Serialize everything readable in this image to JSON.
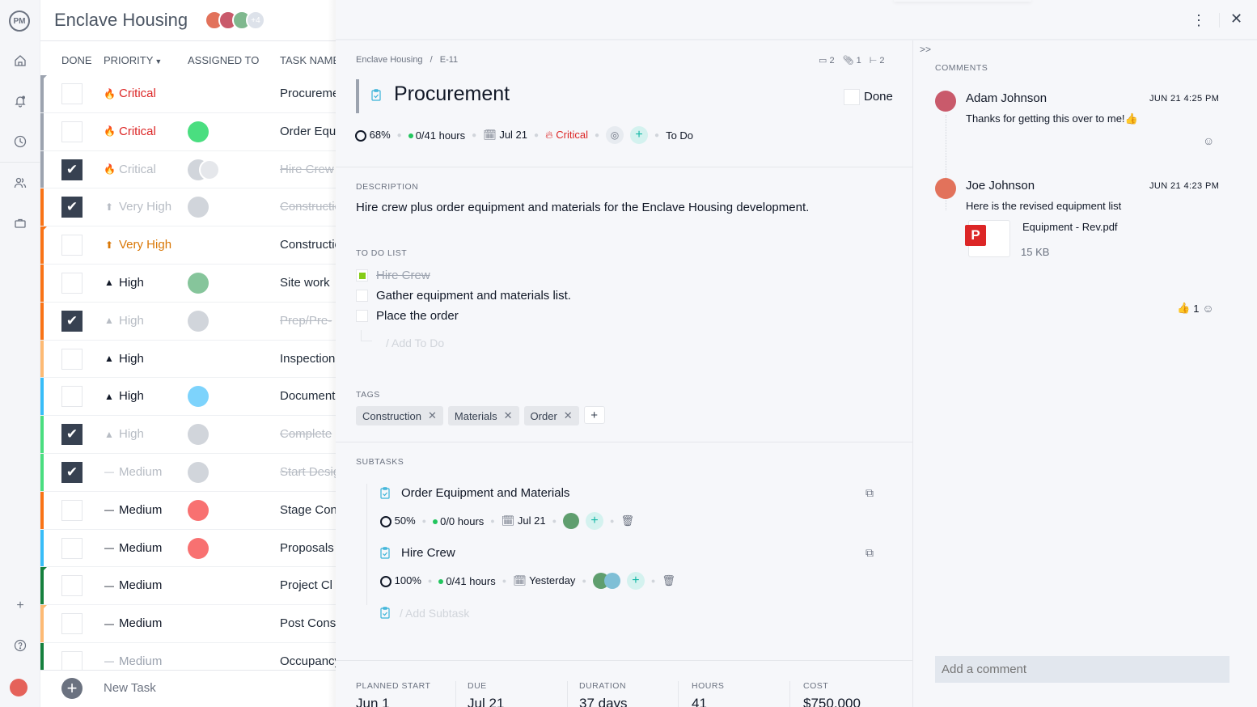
{
  "app": {
    "logo": "PM",
    "project_title": "Enclave Housing",
    "extra_members": "+4"
  },
  "nav": {
    "items": [
      "home",
      "notifications",
      "time",
      "people",
      "portfolio"
    ],
    "add": "+",
    "help": "?"
  },
  "list": {
    "columns": {
      "done": "DONE",
      "priority": "PRIORITY",
      "assigned": "ASSIGNED TO",
      "task": "TASK NAME"
    },
    "rows": [
      {
        "done": false,
        "priority": "Critical",
        "icon": "🔥",
        "color": "#dc2626",
        "task": "Procurement",
        "bar": "#9ca3af",
        "flag": "#9ca3af",
        "avatars": []
      },
      {
        "done": false,
        "priority": "Critical",
        "icon": "🔥",
        "color": "#dc2626",
        "task": "Order Equipment",
        "bar": "#9ca3af",
        "flag": "",
        "avatars": [
          "#4ade80"
        ]
      },
      {
        "done": true,
        "priority": "Critical",
        "icon": "🔥",
        "color": "#b7bcc4",
        "task": "Hire Crew",
        "bar": "#9ca3af",
        "flag": "",
        "avatars": [
          "#d1d5db",
          "#e5e7eb"
        ]
      },
      {
        "done": true,
        "priority": "Very High",
        "icon": "⬆",
        "color": "#b7bcc4",
        "task": "Construction",
        "bar": "#f97316",
        "flag": "",
        "avatars": [
          "#d1d5db"
        ]
      },
      {
        "done": false,
        "priority": "Very High",
        "icon": "⬆",
        "color": "#d97706",
        "task": "Construction",
        "bar": "#f97316",
        "flag": "#f97316",
        "avatars": []
      },
      {
        "done": false,
        "priority": "High",
        "icon": "▲",
        "color": "#111827",
        "task": "Site work",
        "bar": "#f97316",
        "flag": "",
        "avatars": [
          "#86c59b"
        ]
      },
      {
        "done": true,
        "priority": "High",
        "icon": "▲",
        "color": "#b7bcc4",
        "task": "Prep/Pre-",
        "bar": "#f97316",
        "flag": "",
        "avatars": [
          "#d1d5db"
        ]
      },
      {
        "done": false,
        "priority": "High",
        "icon": "▲",
        "color": "#111827",
        "task": "Inspection",
        "bar": "#fdba74",
        "flag": "",
        "avatars": []
      },
      {
        "done": false,
        "priority": "High",
        "icon": "▲",
        "color": "#111827",
        "task": "Document",
        "bar": "#38bdf8",
        "flag": "",
        "avatars": [
          "#7dd3fc"
        ]
      },
      {
        "done": true,
        "priority": "High",
        "icon": "▲",
        "color": "#b7bcc4",
        "task": "Complete",
        "bar": "#4ade80",
        "flag": "",
        "avatars": [
          "#d1d5db"
        ]
      },
      {
        "done": true,
        "priority": "Medium",
        "icon": "—",
        "color": "#b7bcc4",
        "task": "Start Design",
        "bar": "#4ade80",
        "flag": "",
        "avatars": [
          "#d1d5db"
        ]
      },
      {
        "done": false,
        "priority": "Medium",
        "icon": "—",
        "color": "#111827",
        "task": "Stage Con",
        "bar": "#f97316",
        "flag": "",
        "avatars": [
          "#f87171"
        ]
      },
      {
        "done": false,
        "priority": "Medium",
        "icon": "—",
        "color": "#111827",
        "task": "Proposals",
        "bar": "#38bdf8",
        "flag": "",
        "avatars": [
          "#f87171"
        ]
      },
      {
        "done": false,
        "priority": "Medium",
        "icon": "—",
        "color": "#111827",
        "task": "Project Cl",
        "bar": "#15803d",
        "flag": "#15803d",
        "avatars": []
      },
      {
        "done": false,
        "priority": "Medium",
        "icon": "—",
        "color": "#111827",
        "task": "Post Cons",
        "bar": "#fdba74",
        "flag": "#fdba74",
        "avatars": []
      },
      {
        "done": false,
        "priority": "Medium",
        "icon": "—",
        "color": "#9ca3af",
        "task": "Occupancy",
        "bar": "#15803d",
        "flag": "",
        "avatars": []
      }
    ],
    "new_task": "New Task"
  },
  "detail": {
    "breadcrumb": {
      "project": "Enclave Housing",
      "sep": "/",
      "id": "E-11"
    },
    "counts": {
      "comments": "2",
      "attachments": "1",
      "subtasks": "2"
    },
    "title": "Procurement",
    "done_label": "Done",
    "meta": {
      "progress": "68%",
      "hours": "0/41 hours",
      "due": "Jul 21",
      "priority": "Critical",
      "status": "To Do"
    },
    "description_label": "DESCRIPTION",
    "description": "Hire crew plus order equipment and materials for the Enclave Housing development.",
    "todo_label": "TO DO LIST",
    "todos": [
      {
        "text": "Hire Crew",
        "done": true
      },
      {
        "text": "Gather equipment and materials list.",
        "done": false
      },
      {
        "text": "Place the order",
        "done": false
      }
    ],
    "add_todo": "/ Add To Do",
    "tags_label": "TAGS",
    "tags": [
      "Construction",
      "Materials",
      "Order"
    ],
    "subtasks_label": "SUBTASKS",
    "subtasks": [
      {
        "name": "Order Equipment and Materials",
        "progress": "50%",
        "hours": "0/0 hours",
        "due": "Jul 21"
      },
      {
        "name": "Hire Crew",
        "progress": "100%",
        "hours": "0/41 hours",
        "due": "Yesterday"
      }
    ],
    "add_subtask": "/ Add Subtask",
    "footer": [
      {
        "label": "PLANNED START",
        "value": "Jun 1"
      },
      {
        "label": "DUE",
        "value": "Jul 21"
      },
      {
        "label": "DURATION",
        "value": "37 days"
      },
      {
        "label": "HOURS",
        "value": "41"
      },
      {
        "label": "COST",
        "value": "$750,000"
      }
    ]
  },
  "comments": {
    "header": "COMMENTS",
    "items": [
      {
        "author": "Adam Johnson",
        "time": "JUN 21 4:25 PM",
        "text": "Thanks for getting this over to me!👍"
      },
      {
        "author": "Joe Johnson",
        "time": "JUN 21 4:23 PM",
        "text": "Here is the revised equipment list",
        "attachment": {
          "name": "Equipment - Rev.pdf",
          "size": "15 KB",
          "type": "P"
        },
        "reaction": {
          "emoji": "👍",
          "count": "1"
        }
      }
    ],
    "input_placeholder": "Add a comment"
  }
}
